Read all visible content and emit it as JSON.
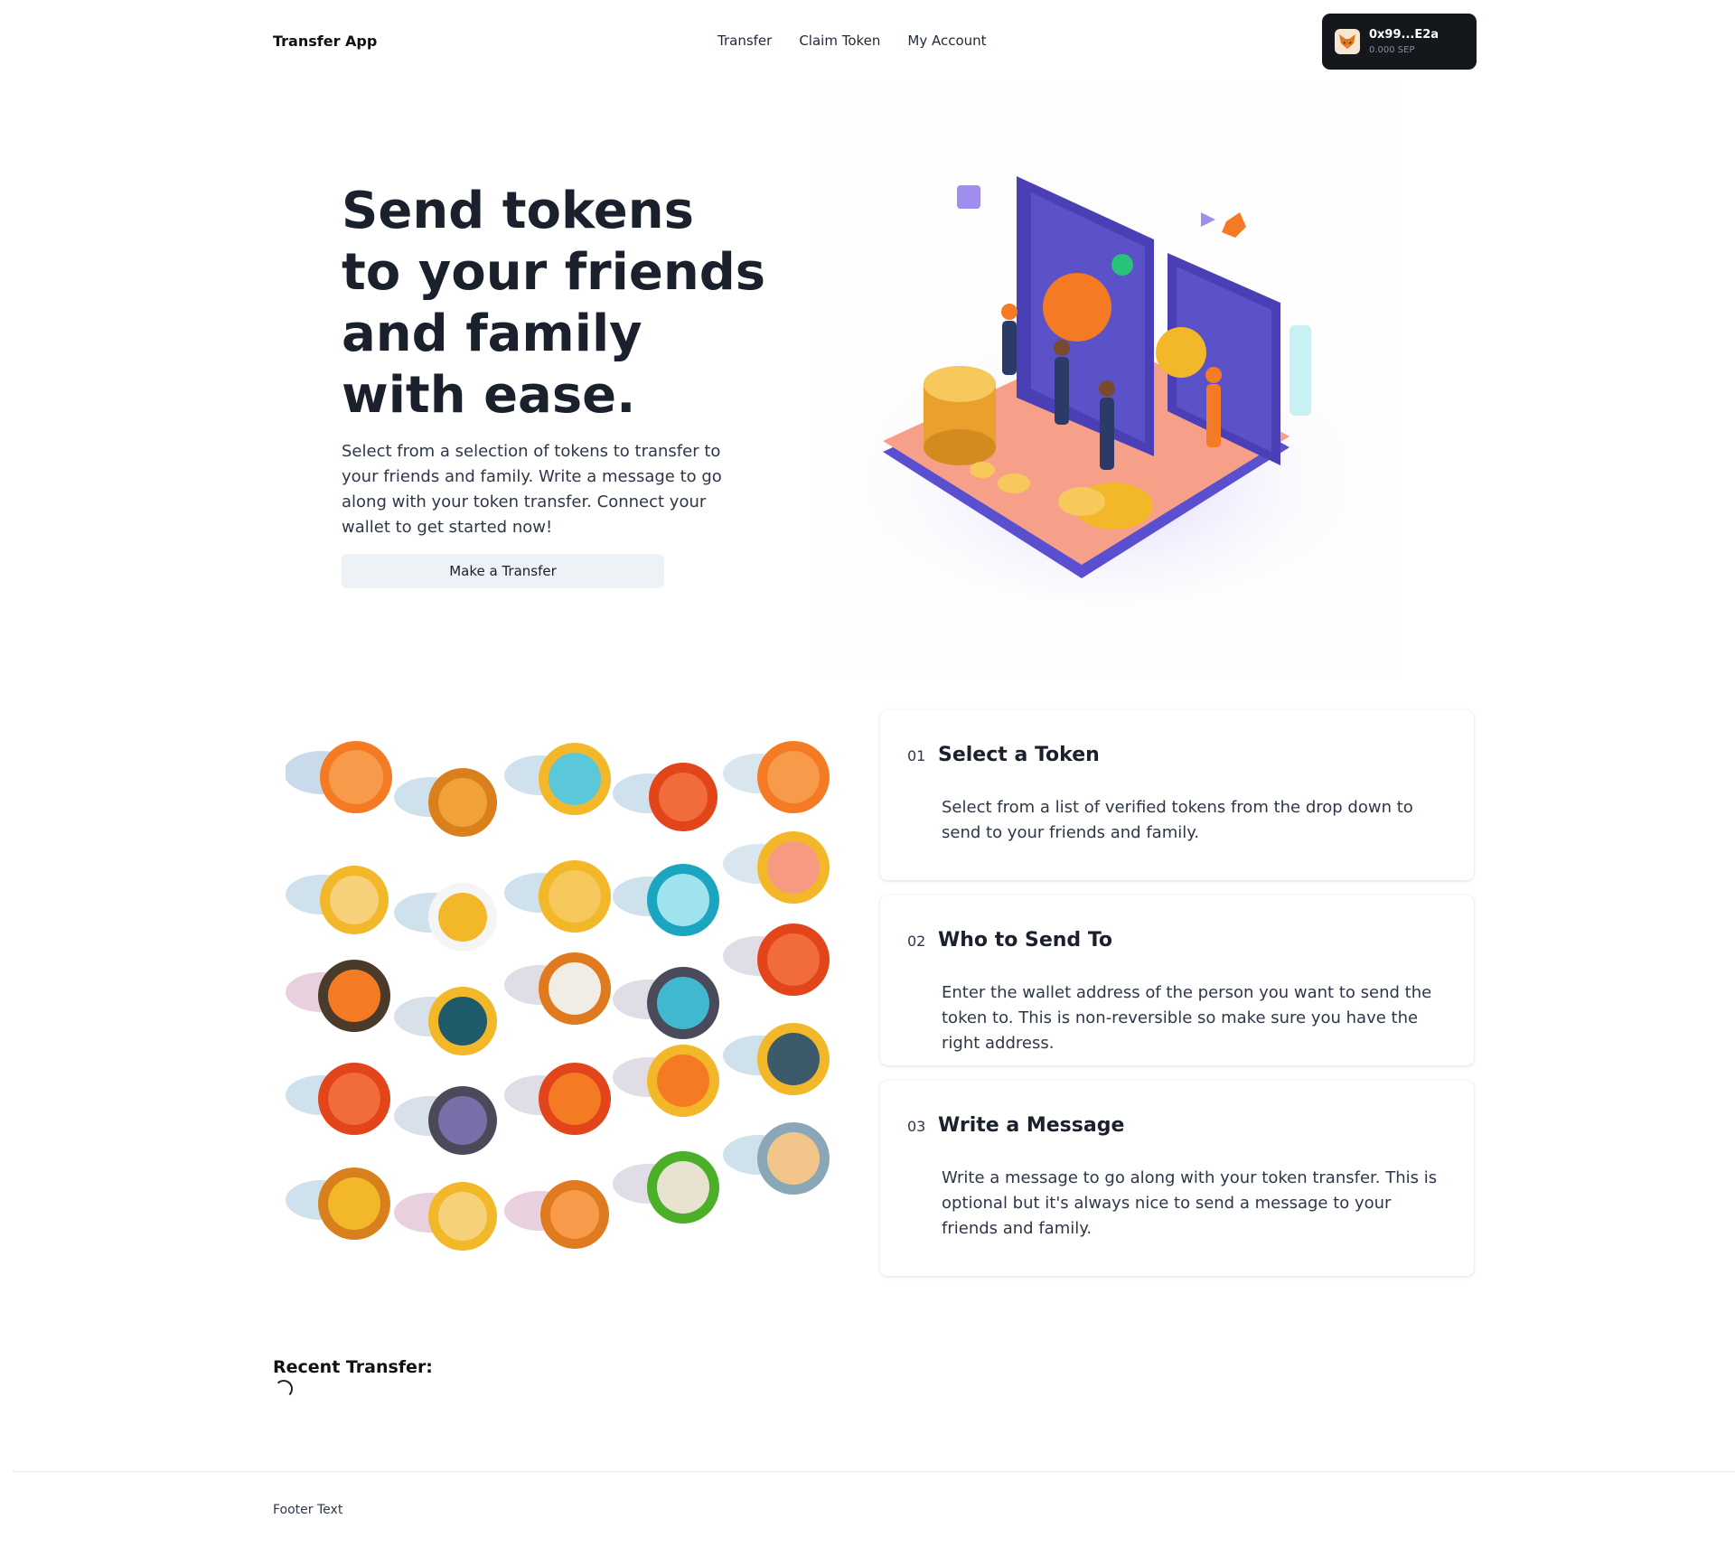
{
  "nav": {
    "brand": "Transfer App",
    "links": [
      "Transfer",
      "Claim Token",
      "My Account"
    ],
    "wallet": {
      "address": "0x99...E2a",
      "balance": "0.000 SEP",
      "icon": "metamask-fox-icon"
    }
  },
  "hero": {
    "title": "Send tokens to your friends and family with ease.",
    "description": "Select from a selection of tokens to transfer to your friends and family. Write a message to go along with your token transfer. Connect your wallet to get started now!",
    "cta_label": "Make a Transfer"
  },
  "steps": [
    {
      "num": "01",
      "title": "Select a Token",
      "body": "Select from a list of verified tokens from the drop down to send to your friends and family."
    },
    {
      "num": "02",
      "title": "Who to Send To",
      "body": "Enter the wallet address of the person you want to send the token to. This is non-reversible so make sure you have the right address."
    },
    {
      "num": "03",
      "title": "Write a Message",
      "body": "Write a message to go along with your token transfer. This is optional but it's always nice to send a message to your friends and family."
    }
  ],
  "recent": {
    "heading": "Recent Transfer:"
  },
  "footer": {
    "text": "Footer Text"
  },
  "colors": {
    "wallet_bg": "#14171c",
    "cta_bg": "#edf2f7",
    "coin_gold": "#f3b82a",
    "coin_orange": "#f47b24",
    "phone_purple": "#5b4fc7",
    "platform_salmon": "#f79a82"
  }
}
